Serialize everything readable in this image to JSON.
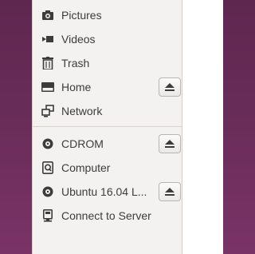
{
  "sidebar": {
    "places": [
      {
        "label": "Pictures",
        "icon": "camera-icon"
      },
      {
        "label": "Videos",
        "icon": "video-icon"
      },
      {
        "label": "Trash",
        "icon": "trash-icon"
      },
      {
        "label": "Home",
        "icon": "home-folder-icon",
        "eject": true
      },
      {
        "label": "Network",
        "icon": "network-icon"
      }
    ],
    "devices": [
      {
        "label": "CDROM",
        "icon": "disc-icon",
        "eject": true
      },
      {
        "label": "Computer",
        "icon": "computer-icon"
      },
      {
        "label": "Ubuntu 16.04 L...",
        "icon": "disc-icon",
        "eject": true
      },
      {
        "label": "Connect to Server",
        "icon": "server-icon"
      }
    ]
  }
}
